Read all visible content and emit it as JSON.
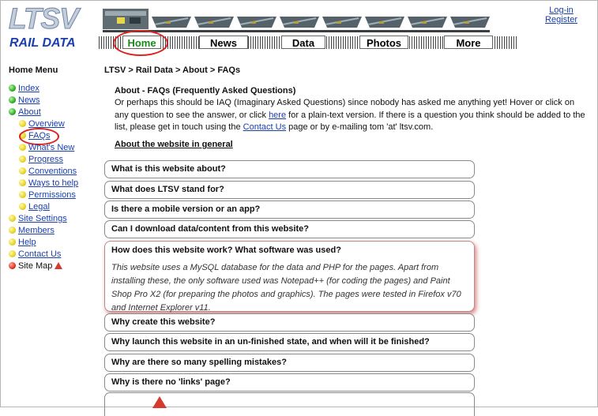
{
  "header": {
    "logo_big": "LTSV",
    "logo_small": "RAIL DATA",
    "login": "Log-in",
    "register": "Register",
    "nav": [
      "Home",
      "News",
      "Data",
      "Photos",
      "More"
    ]
  },
  "breadcrumb": "LTSV > Rail Data > About > FAQs",
  "menu": {
    "title": "Home Menu",
    "items": {
      "index": "Index",
      "news": "News",
      "about": "About",
      "overview": "Overview",
      "faqs": "FAQs",
      "whats_new": "What's New",
      "progress": "Progress",
      "conventions": "Conventions",
      "ways_to_help": "Ways to help",
      "permissions": "Permissions",
      "legal": "Legal",
      "site_settings": "Site Settings",
      "members": "Members",
      "help": "Help",
      "contact_us": "Contact Us",
      "site_map": "Site Map"
    }
  },
  "intro": {
    "title": "About - FAQs (Frequently Asked Questions)",
    "text_1": "Or perhaps this should be IAQ (Imaginary Asked Questions) since nobody has asked me anything yet! Hover or click on any question to see the answer, or click ",
    "here": "here",
    "text_2": " for a plain-text version. If there is a question you think should be added to the list, please get in touch using the ",
    "contact_link": "Contact Us",
    "text_3": " page or by e-mailing tom 'at' ltsv.com."
  },
  "section_heading": "About the website in general",
  "faqs": [
    "What is this website about?",
    "What does LTSV stand for?",
    "Is there a mobile version or an app?",
    "Can I download data/content from this website?",
    "How does this website work? What software was used?",
    "Why create this website?",
    "Why launch this website in an un-finished state, and when will it be finished?",
    "Why are there so many spelling mistakes?",
    "Why is there no 'links' page?"
  ],
  "open_answer": "This website uses a MySQL database for the data and PHP for the pages. Apart from installing these, the only software used was Notepad++ (for coding the pages) and Paint Shop Pro X2 (for preparing the photos and graphics). The pages were tested in Firefox v70 and Internet Explorer v11."
}
